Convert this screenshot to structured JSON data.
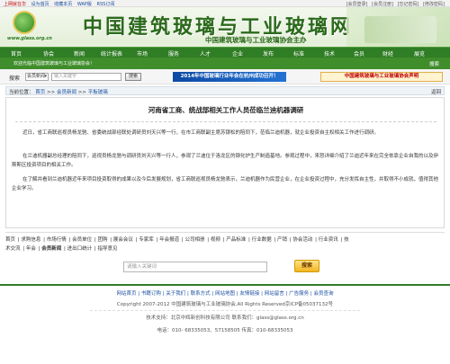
{
  "topbar": {
    "left_links": [
      "上网就在华",
      "设为首页",
      "收藏本页",
      "WAP版",
      "RSS订阅"
    ],
    "right_links": [
      "[会员登录]",
      "[会员注册]",
      "[忘记密码]",
      "[修改密码]"
    ]
  },
  "banner": {
    "logo_url": "www.glass.org.cn",
    "title": "中国建筑玻璃与工业玻璃网",
    "subtitle": "中国建筑玻璃与工业玻璃协会主办"
  },
  "nav": {
    "items": [
      "首页",
      "协会",
      "新闻",
      "统计报表",
      "市场",
      "服务",
      "人才",
      "企业",
      "发布",
      "标准",
      "技术",
      "会员",
      "财经",
      "展览"
    ]
  },
  "subbar": {
    "welcome": "欢迎光临中国建筑玻璃与工业玻璃协会！",
    "right": "搜索"
  },
  "search": {
    "label": "搜索",
    "select_value": "会员新闻",
    "placeholder": "输入关键字",
    "button": "搜索"
  },
  "ads": {
    "ad1": "2014年中国玻璃行业年会在杭州成功召开！",
    "ad2": "中国建筑玻璃与工业玻璃协会声明"
  },
  "breadcrumb": {
    "prefix": "当前位置：",
    "items": [
      "首页",
      "会员新闻",
      "平板玻璃"
    ],
    "back": "返回"
  },
  "article": {
    "title": "河南省工商、统战部相关工作人员莅临兰迪机器调研",
    "paragraphs": [
      "近日，省工商联巡视员杨龙驰、省委统战部经联处调研员刘天兴等一行，在市工商联副主席苏银松的陪同下，莅临兰迪机器，就企业投资自主权相关工作进行调研。",
      "在兰迪机器副总经理的陪同下，巡视员杨龙驰与调研员刘天兴等一行人，参观了兰迪位于洛龙区的钢化炉生产制造基地。参观过程中，来怒详细介绍了兰迪近年来在完全依靠企业自我的以及伊斯斯区投资项目的相关工作。",
      "在了解并看到兰迪机器近年来项目投资取得的成果以及今后发展规划，省工商联巡视员杨龙驰表示，兰迪机器作为民营企业，在企业投资过程中，充分发挥自主性，并取得不小成就，值得其他企业学习。"
    ]
  },
  "footer_links": {
    "row1": [
      "首页",
      "求购信息",
      "市场行情",
      "会员单位",
      "团购",
      "展会会议",
      "专家库",
      "年会报道",
      "公司相册",
      "视频",
      "产品标准",
      "行业数据",
      "产销",
      "协会活动",
      "行业资讯",
      "技"
    ],
    "row2": [
      "术交流",
      "年会",
      "会员新闻",
      "进出口统计",
      "指导意见"
    ],
    "search_placeholder": "请输入关键词",
    "search_button": "搜索"
  },
  "bottom": {
    "links": [
      "网站首页",
      "书籍订购",
      "关于我们",
      "联系方式",
      "网站地图",
      "友情链接",
      "网站留言",
      "广告服务",
      "会员查询"
    ],
    "copyright": "Copyright 2007-2012 中国建筑玻璃与工业玻璃协会,All Rights Reserved京ICP备05037132号",
    "support": "技术支持：北京中辉新创科技有限公司 联系我们：glass@glass.org.cn",
    "phone": "电话：010- 68335053、57158505 传真：010-68335053"
  }
}
